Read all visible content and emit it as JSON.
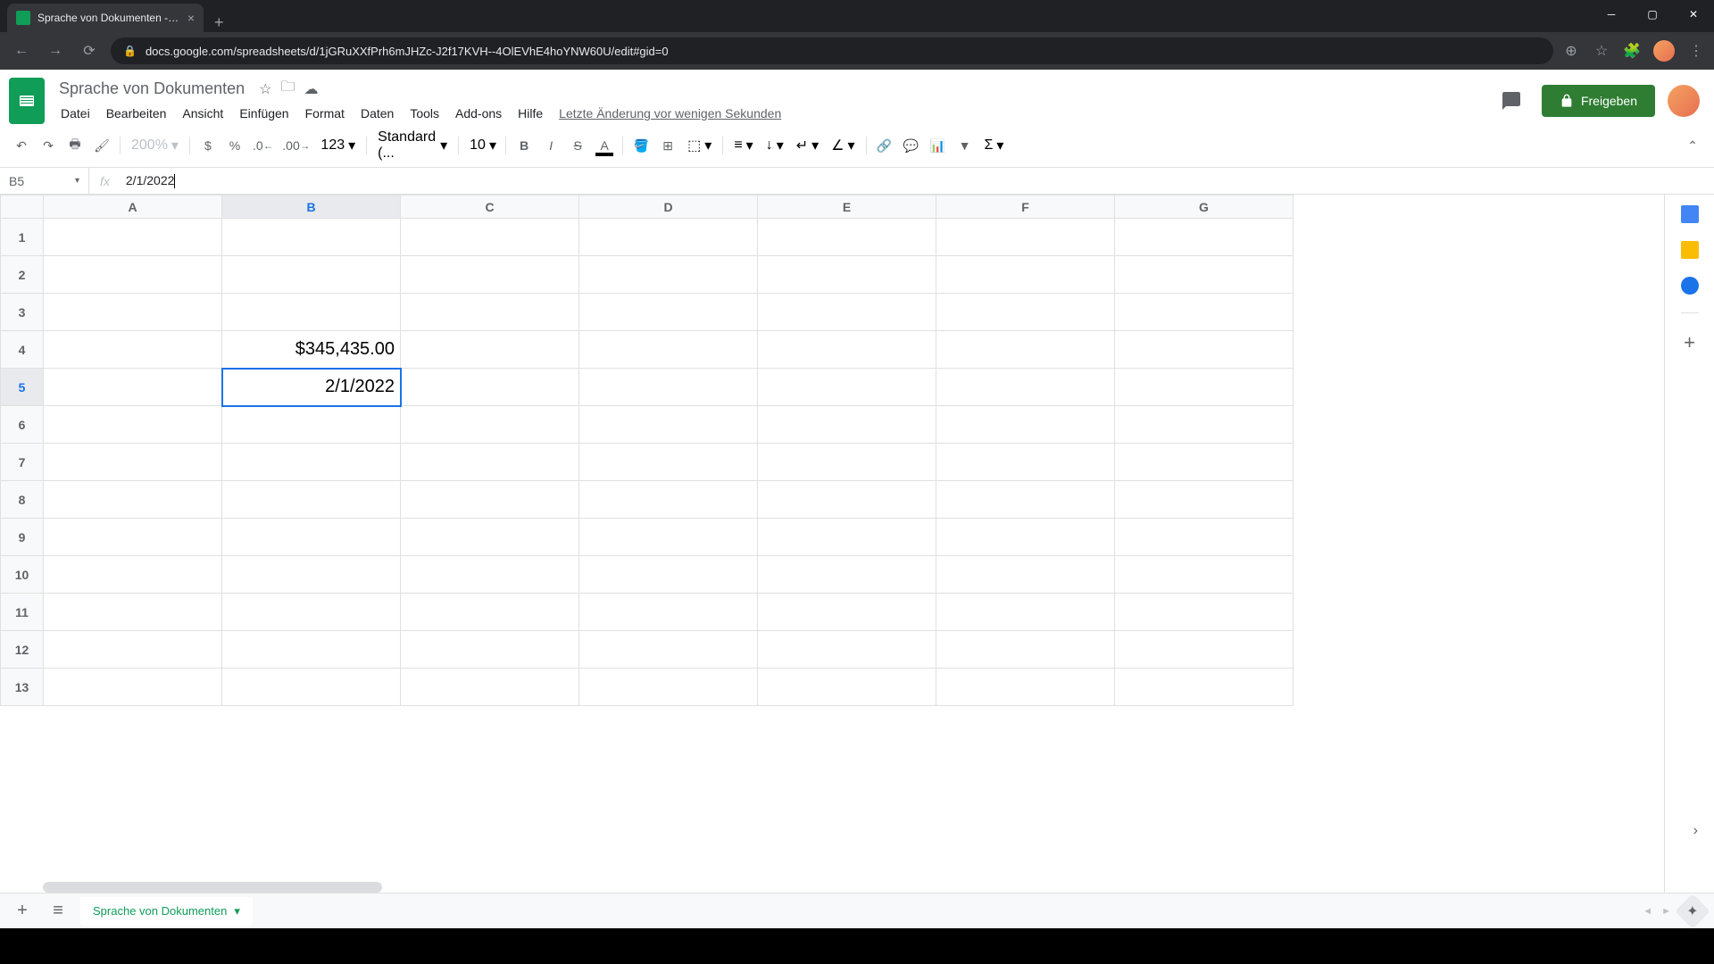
{
  "browser": {
    "tab_title": "Sprache von Dokumenten - Goo...",
    "url": "docs.google.com/spreadsheets/d/1jGRuXXfPrh6mJHZc-J2f17KVH--4OlEVhE4hoYNW60U/edit#gid=0"
  },
  "doc": {
    "title": "Sprache von Dokumenten",
    "last_edit": "Letzte Änderung vor wenigen Sekunden",
    "share_label": "Freigeben"
  },
  "menu": {
    "file": "Datei",
    "edit": "Bearbeiten",
    "view": "Ansicht",
    "insert": "Einfügen",
    "format": "Format",
    "data": "Daten",
    "tools": "Tools",
    "addons": "Add-ons",
    "help": "Hilfe"
  },
  "toolbar": {
    "zoom": "200%",
    "currency": "$",
    "percent": "%",
    "dec_decrease": ".0",
    "dec_increase": ".00",
    "more_formats": "123",
    "font": "Standard (...",
    "font_size": "10"
  },
  "formula": {
    "name_box": "B5",
    "fx": "fx",
    "value": "2/1/2022"
  },
  "columns": [
    "A",
    "B",
    "C",
    "D",
    "E",
    "F",
    "G"
  ],
  "rows": [
    "1",
    "2",
    "3",
    "4",
    "5",
    "6",
    "7",
    "8",
    "9",
    "10",
    "11",
    "12",
    "13"
  ],
  "cells": {
    "B4": "$345,435.00",
    "B5": "2/1/2022"
  },
  "selected_cell": "B5",
  "sheet": {
    "name": "Sprache von Dokumenten"
  }
}
